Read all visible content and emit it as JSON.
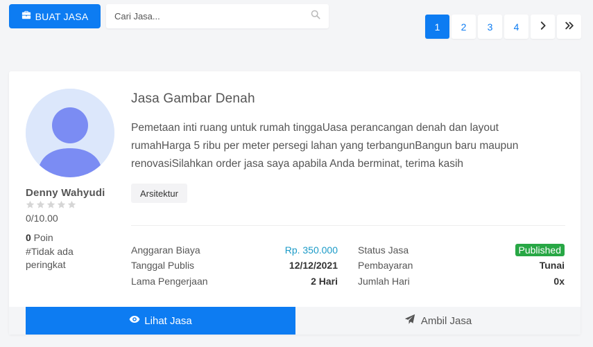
{
  "toolbar": {
    "create_label": "BUAT JASA",
    "search_placeholder": "Cari Jasa..."
  },
  "pagination": {
    "pages": [
      "1",
      "2",
      "3",
      "4"
    ],
    "active_page": "1"
  },
  "colors": {
    "primary": "#0d7cf2",
    "success": "#28a745",
    "price": "#1a9ac7"
  },
  "profile": {
    "name": "Denny Wahyudi",
    "stars_filled": 0,
    "stars_total": 5,
    "rating": "0/10.00",
    "poin_value": "0",
    "poin_label": " Poin",
    "rank": "#Tidak ada peringkat"
  },
  "service": {
    "title": "Jasa Gambar Denah",
    "description": "Pemetaan inti ruang untuk rumah tinggaUasa perancangan denah dan layout rumahHarga 5 ribu per meter persegi lahan yang terbangunBangun baru maupun renovasiSilahkan order jasa saya apabila Anda berminat, terima kasih",
    "tag": "Arsitektur",
    "details_left": [
      {
        "label": "Anggaran Biaya",
        "value": "Rp. 350.000"
      },
      {
        "label": "Tanggal Publis",
        "value": "12/12/2021"
      },
      {
        "label": "Lama Pengerjaan",
        "value": "2 Hari"
      }
    ],
    "details_right": [
      {
        "label": "Status Jasa",
        "value": "Published"
      },
      {
        "label": "Pembayaran",
        "value": "Tunai"
      },
      {
        "label": "Jumlah Hari",
        "value": "0x"
      }
    ]
  },
  "actions": {
    "view_label": "Lihat Jasa",
    "take_label": "Ambil Jasa"
  },
  "icons": [
    "briefcase-icon",
    "search-icon",
    "next-page-icon",
    "last-page-icon",
    "user-avatar-icon",
    "star-icon",
    "eye-icon",
    "paper-plane-icon"
  ]
}
